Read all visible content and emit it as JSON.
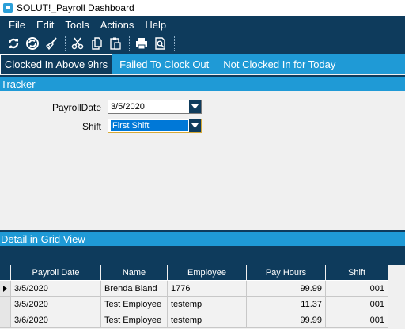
{
  "window": {
    "title": "SOLUT!_Payroll Dashboard"
  },
  "menu": [
    "File",
    "Edit",
    "Tools",
    "Actions",
    "Help"
  ],
  "toolbar": {
    "icons": [
      "refresh-icon",
      "sync-icon",
      "broom-icon",
      "cut-icon",
      "copy-icon",
      "paste-icon",
      "print-icon",
      "print-preview-icon"
    ]
  },
  "tabs": [
    {
      "label": "Clocked In Above 9hrs",
      "active": true
    },
    {
      "label": "Failed To Clock Out",
      "active": false
    },
    {
      "label": "Not Clocked In for Today",
      "active": false
    }
  ],
  "tracker": {
    "header": "Tracker",
    "payroll_date_label": "PayrollDate",
    "payroll_date_value": "3/5/2020",
    "shift_label": "Shift",
    "shift_value": "First Shift"
  },
  "grid": {
    "header": "Detail in Grid View",
    "columns": [
      "Payroll Date",
      "Name",
      "Employee",
      "Pay Hours",
      "Shift"
    ],
    "rows": [
      [
        "3/5/2020",
        "Brenda Bland",
        "1776",
        "99.99",
        "001"
      ],
      [
        "3/5/2020",
        "Test Employee",
        "testemp",
        "11.37",
        "001"
      ],
      [
        "3/6/2020",
        "Test Employee",
        "testemp",
        "99.99",
        "001"
      ]
    ]
  },
  "colors": {
    "dark_navy": "#0e3b5c",
    "accent_blue": "#1f9ad6",
    "selection_blue": "#0078d7"
  }
}
